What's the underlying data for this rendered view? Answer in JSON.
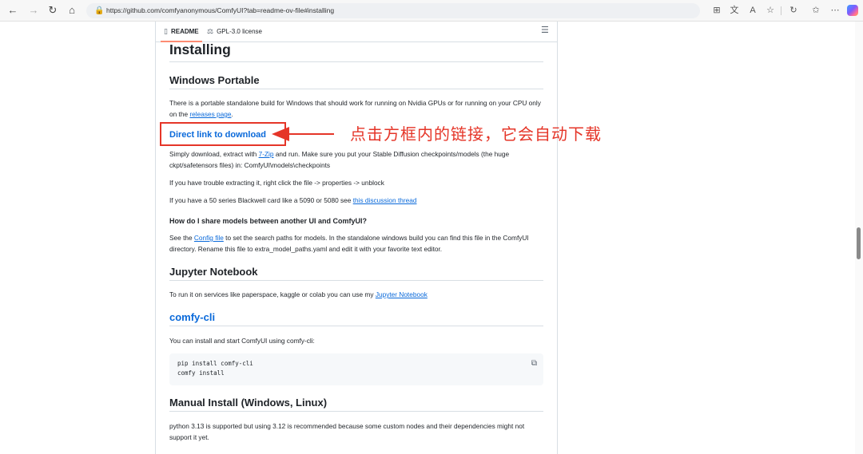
{
  "browser": {
    "url": "https://github.com/comfyanonymous/ComfyUI?tab=readme-ov-file#installing",
    "back_icon": "←",
    "forward_icon": "→",
    "reload_icon": "↻",
    "home_icon": "⌂",
    "more_icon": "⋯"
  },
  "readme_tabs": [
    {
      "label": "README",
      "icon": "▯"
    },
    {
      "label": "GPL-3.0 license",
      "icon": "⚖"
    }
  ],
  "doc": {
    "installing_heading": "Installing",
    "windows_portable_heading": "Windows Portable",
    "wp_para_pre": "There is a portable standalone build for Windows that should work for running on Nvidia GPUs or for running on your CPU only on the ",
    "wp_para_link": "releases page",
    "wp_para_post": ".",
    "direct_link": "Direct link to download",
    "simply_pre": "Simply download, extract with ",
    "simply_link": "7-Zip",
    "simply_post": " and run. Make sure you put your Stable Diffusion checkpoints/models (the huge ckpt/safetensors files) in: ComfyUI\\models\\checkpoints",
    "trouble_para": "If you have trouble extracting it, right click the file -> properties -> unblock",
    "blackwell_pre": "If you have a 50 series Blackwell card like a 5090 or 5080 see ",
    "blackwell_link": "this discussion thread",
    "share_heading": "How do I share models between another UI and ComfyUI?",
    "config_pre": "See the ",
    "config_link": "Config file",
    "config_post": " to set the search paths for models. In the standalone windows build you can find this file in the ComfyUI directory. Rename this file to extra_model_paths.yaml and edit it with your favorite text editor.",
    "jupyter_heading": "Jupyter Notebook",
    "jupyter_pre": "To run it on services like paperspace, kaggle or colab you can use my ",
    "jupyter_link": "Jupyter Notebook",
    "comfycli_heading": "comfy-cli",
    "comfycli_para": "You can install and start ComfyUI using comfy-cli:",
    "code_line_1": "pip install comfy-cli",
    "code_line_2": "comfy install",
    "manual_heading": "Manual Install (Windows, Linux)",
    "manual_para": "python 3.13 is supported but using 3.12 is recommended because some custom nodes and their dependencies might not support it yet."
  },
  "annotation": {
    "text": "点击方框内的链接，它会自动下载",
    "color": "#e53528"
  },
  "colors": {
    "link": "#0969da",
    "text": "#1f2328",
    "border": "#d8dee4",
    "tab_underline": "#fd8c73"
  }
}
